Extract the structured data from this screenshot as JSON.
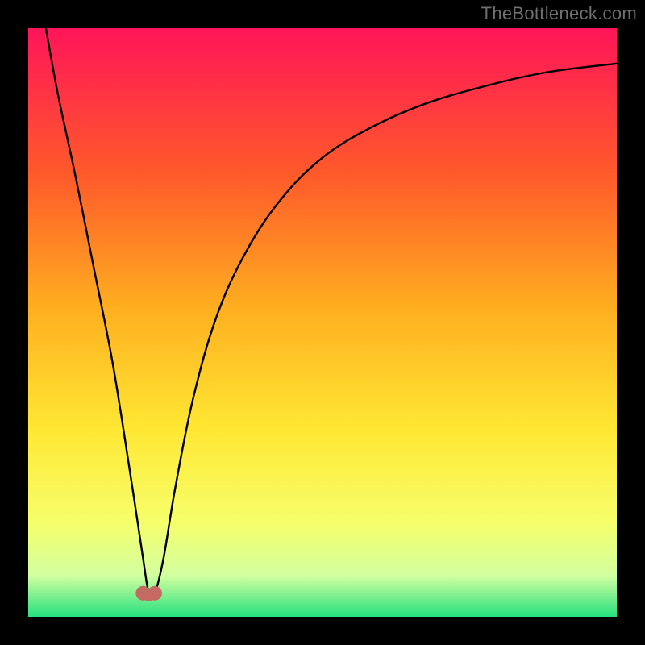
{
  "watermark": "TheBottleneck.com",
  "colors": {
    "frame": "#000000",
    "curve": "#000000",
    "marker": "#c46a63",
    "watermark": "#707070",
    "gradient_top": "#ff1559",
    "gradient_mid1": "#ff5a2a",
    "gradient_mid2": "#ffb020",
    "gradient_mid3": "#ffe733",
    "gradient_mid4": "#f6ff6b",
    "gradient_mid5": "#d2ffa0",
    "gradient_bottom": "#26e07f"
  },
  "chart_data": {
    "type": "line",
    "title": "",
    "xlabel": "",
    "ylabel": "",
    "xlim": [
      0,
      100
    ],
    "ylim": [
      0,
      100
    ],
    "grid": false,
    "series": [
      {
        "name": "bottleneck-curve",
        "x": [
          3,
          5,
          8,
          11,
          14,
          16,
          18,
          19.5,
          20.5,
          21.5,
          23,
          25,
          28,
          32,
          37,
          43,
          50,
          58,
          67,
          77,
          88,
          100
        ],
        "y": [
          100,
          89,
          75,
          60,
          45,
          33,
          20,
          10,
          4,
          4,
          10,
          22,
          37,
          51,
          62,
          71,
          78,
          83,
          87,
          90,
          92.5,
          94
        ]
      }
    ],
    "markers": [
      {
        "name": "min-left",
        "x": 19.5,
        "y": 4
      },
      {
        "name": "min-right",
        "x": 21.5,
        "y": 4
      }
    ],
    "marker_connector": {
      "from": 0,
      "to": 1
    }
  }
}
